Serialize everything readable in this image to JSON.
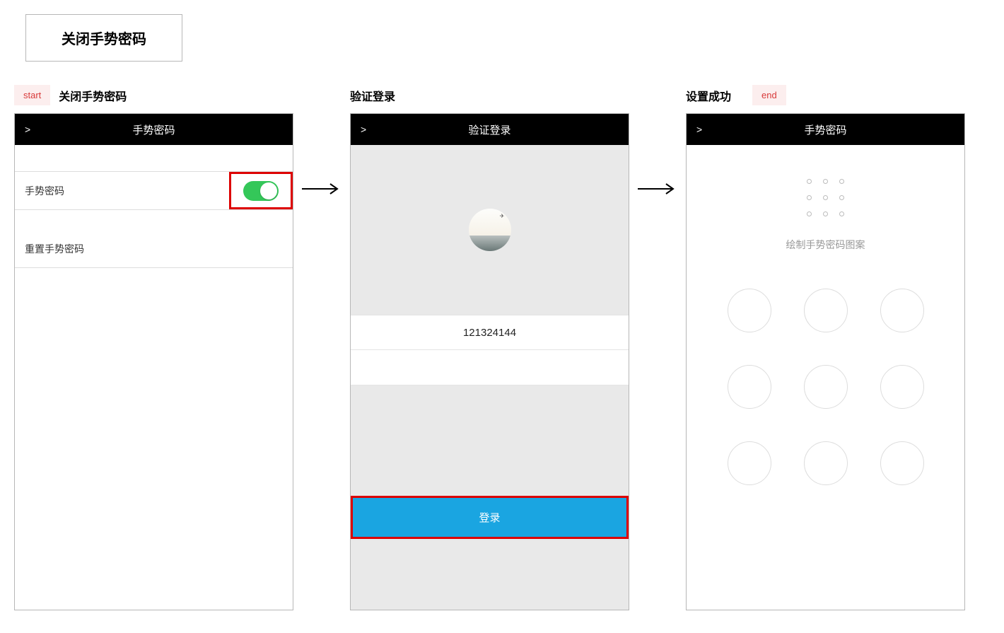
{
  "main_title": "关闭手势密码",
  "badges": {
    "start": "start",
    "end": "end"
  },
  "col1": {
    "label": "关闭手势密码",
    "header_back": ">",
    "header_title": "手势密码",
    "row_toggle_label": "手势密码",
    "row_reset_label": "重置手势密码"
  },
  "col2": {
    "label": "验证登录",
    "header_back": ">",
    "header_title": "验证登录",
    "input_value": "121324144",
    "login_btn": "登录"
  },
  "col3": {
    "label": "设置成功",
    "header_back": ">",
    "header_title": "手势密码",
    "hint": "绘制手势密码图案"
  }
}
